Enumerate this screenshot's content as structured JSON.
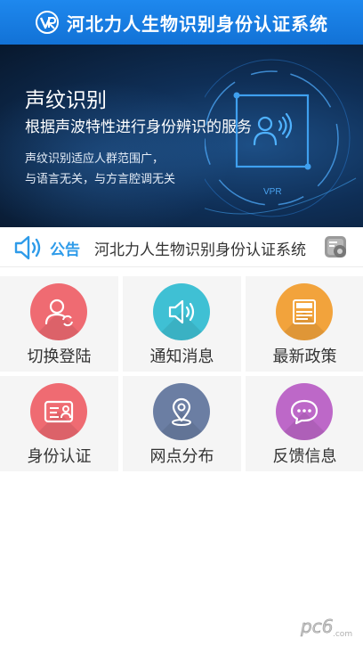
{
  "header": {
    "title": "河北力人生物识别身份认证系统",
    "logo_icon": "vr-logo-icon"
  },
  "banner": {
    "heading": "声纹识别",
    "subheading": "根据声波特性进行身份辨识的服务",
    "desc_line1": "声纹识别适应人群范围广，",
    "desc_line2": "与语言无关，与方言腔调无关",
    "graphic_label": "VPR"
  },
  "notice": {
    "label": "公告",
    "text": "河北力人生物识别身份认证系统",
    "speaker_icon": "speaker-icon",
    "settings_icon": "settings-icon"
  },
  "menu": [
    {
      "label": "切换登陆",
      "icon": "user-switch-icon",
      "color": "#ef6b72"
    },
    {
      "label": "通知消息",
      "icon": "speaker-icon",
      "color": "#3fc0d4"
    },
    {
      "label": "最新政策",
      "icon": "news-icon",
      "color": "#f2a33c"
    },
    {
      "label": "身份认证",
      "icon": "id-card-icon",
      "color": "#ef6b72"
    },
    {
      "label": "网点分布",
      "icon": "location-pin-icon",
      "color": "#6b7ea3"
    },
    {
      "label": "反馈信息",
      "icon": "chat-bubble-icon",
      "color": "#bd68c8"
    }
  ],
  "watermark": {
    "text": "pc6",
    "sub": ".com"
  }
}
